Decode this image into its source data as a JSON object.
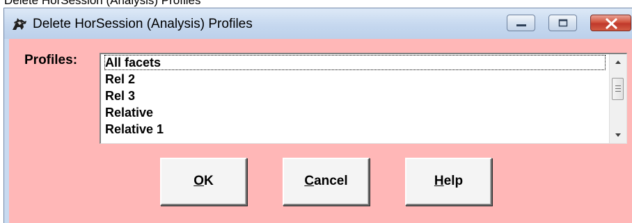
{
  "background_caption": "Delete HorSession (Analysis) Profiles",
  "window": {
    "title": "Delete HorSession (Analysis) Profiles",
    "app_icon": "horse-rider-icon",
    "caption_buttons": [
      "minimize-icon",
      "maximize-icon",
      "close-icon"
    ]
  },
  "dialog": {
    "profiles_label": "Profiles:",
    "profiles": [
      "All facets",
      "Rel 2",
      "Rel 3",
      "Relative",
      "Relative 1"
    ],
    "focused_index": 0,
    "buttons": {
      "ok": {
        "mnemonic": "O",
        "rest": "K"
      },
      "cancel": {
        "mnemonic": "C",
        "rest": "ancel"
      },
      "help": {
        "mnemonic": "H",
        "rest": "elp"
      }
    }
  },
  "colors": {
    "client_background": "#ffb7b7",
    "titlebar": "#c8daf0",
    "close_button": "#c0392b"
  }
}
